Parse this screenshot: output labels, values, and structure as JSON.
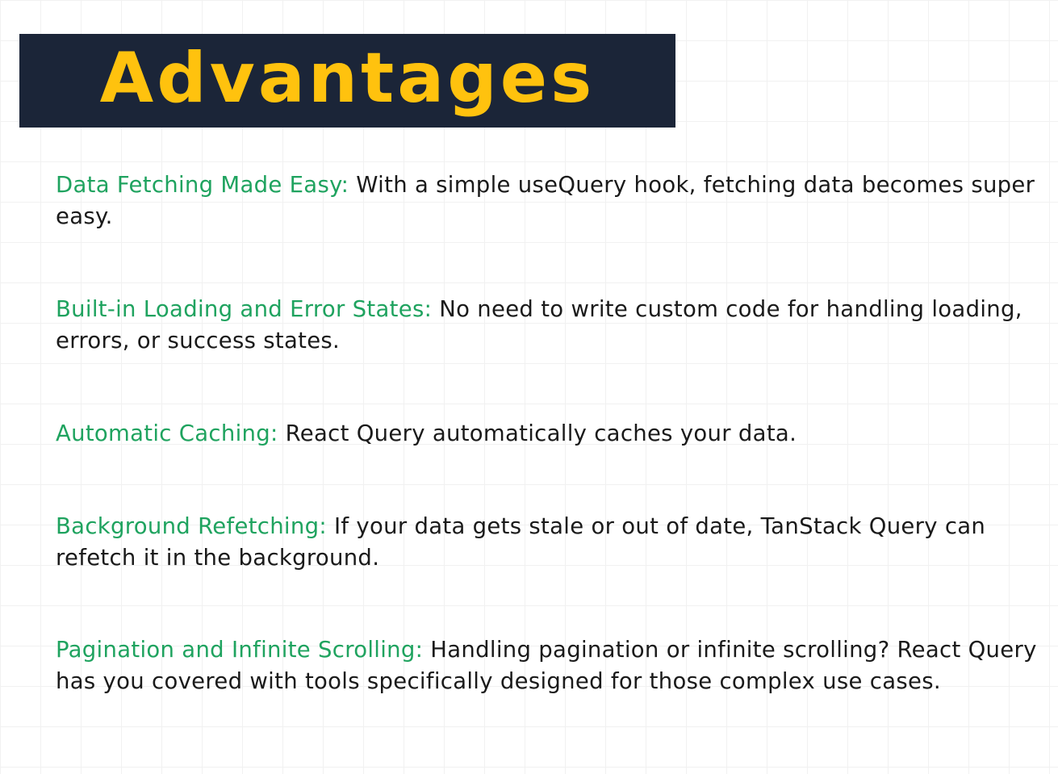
{
  "title": "Advantages",
  "colors": {
    "banner_bg": "#1b2538",
    "title": "#ffc20e",
    "label": "#1fa35f",
    "text": "#1a1a1a"
  },
  "items": [
    {
      "label": "Data Fetching Made Easy:",
      "text": "With a simple useQuery hook, fetching data becomes super easy."
    },
    {
      "label": "Built-in Loading and Error States:",
      "text": "No need to write custom code for handling loading, errors, or success states."
    },
    {
      "label": "Automatic Caching:",
      "text": "React Query automatically caches your data."
    },
    {
      "label": "Background Refetching:",
      "text": "If your data gets stale or out of date, TanStack Query can refetch it in the background."
    },
    {
      "label": "Pagination and Infinite Scrolling:",
      "text": "Handling pagination or infinite scrolling? React Query has you covered with tools specifically designed for those complex use cases."
    }
  ]
}
